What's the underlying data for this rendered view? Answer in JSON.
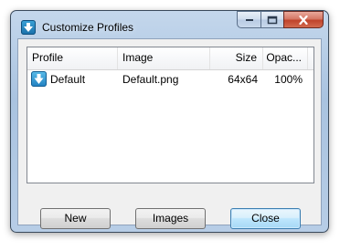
{
  "window": {
    "title": "Customize Profiles"
  },
  "listview": {
    "columns": [
      "Profile",
      "Image",
      "Size",
      "Opac..."
    ],
    "rows": [
      {
        "profile": "Default",
        "image": "Default.png",
        "size": "64x64",
        "opacity": "100%"
      }
    ]
  },
  "buttons": {
    "new_label": "New",
    "images_label": "Images",
    "close_label": "Close"
  },
  "icons": {
    "app": "download-arrow-icon",
    "profile": "download-arrow-icon"
  },
  "colors": {
    "title_bar": "#b7cde6",
    "close_button": "#c0432b",
    "default_button_border": "#3c7fb1"
  }
}
